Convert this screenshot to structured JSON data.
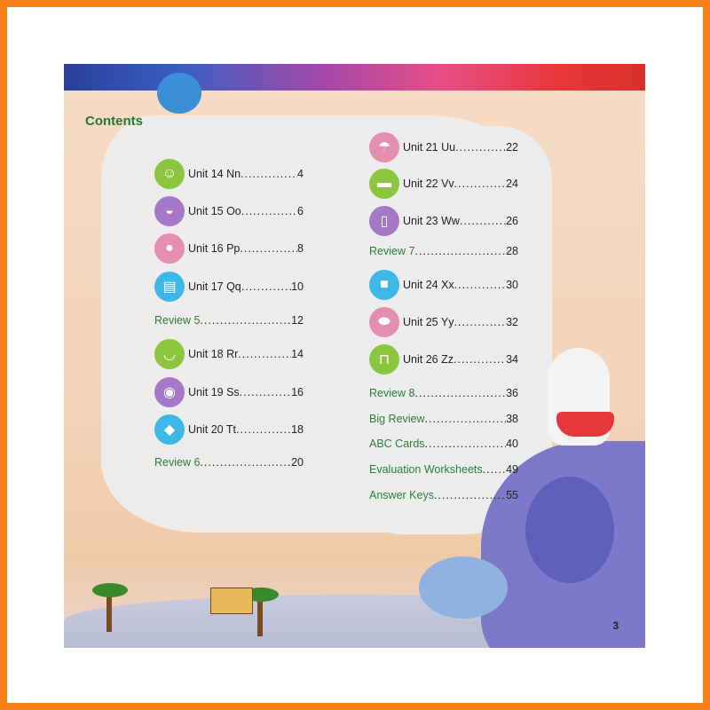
{
  "title": "Contents",
  "page_number": "3",
  "colors": {
    "accent_green": "#2a7d3c",
    "border_orange": "#f57f17"
  },
  "left_column": [
    {
      "label": "Unit 14 Nn",
      "page": "4",
      "icon": "boy-face-icon",
      "icon_color": "#8cc63f"
    },
    {
      "label": "Unit 15 Oo",
      "page": "6",
      "icon": "omelet-plate-icon",
      "icon_color": "#a678c8"
    },
    {
      "label": "Unit 16 Pp",
      "page": "8",
      "icon": "pear-icon",
      "icon_color": "#e48fb0"
    },
    {
      "label": "Unit 17 Qq",
      "page": "10",
      "icon": "quilt-icon",
      "icon_color": "#3db8e6"
    },
    {
      "label": "Review 5",
      "page": "12",
      "review": true
    },
    {
      "label": "Unit 18 Rr",
      "page": "14",
      "icon": "rice-bowl-icon",
      "icon_color": "#8cc63f"
    },
    {
      "label": "Unit 19 Ss",
      "page": "16",
      "icon": "soup-icon",
      "icon_color": "#a678c8"
    },
    {
      "label": "Unit 20 Tt",
      "page": "18",
      "icon": "toast-icon",
      "icon_color": "#3db8e6"
    },
    {
      "label": "Review 6",
      "page": "20",
      "review": true
    }
  ],
  "right_column": [
    {
      "label": "Unit 21 Uu",
      "page": "22",
      "icon": "umbrella-icon",
      "icon_color": "#e48fb0"
    },
    {
      "label": "Unit 22 Vv",
      "page": "24",
      "icon": "van-icon",
      "icon_color": "#8cc63f"
    },
    {
      "label": "Unit 23 Ww",
      "page": "26",
      "icon": "water-glass-icon",
      "icon_color": "#a678c8"
    },
    {
      "label": "Review 7",
      "page": "28",
      "review": true
    },
    {
      "label": "Unit 24 Xx",
      "page": "30",
      "icon": "box-icon",
      "icon_color": "#3db8e6"
    },
    {
      "label": "Unit 25 Yy",
      "page": "32",
      "icon": "yam-icon",
      "icon_color": "#e48fb0"
    },
    {
      "label": "Unit 26 Zz",
      "page": "34",
      "icon": "zipline-icon",
      "icon_color": "#8cc63f"
    },
    {
      "label": "Review 8",
      "page": "36",
      "review": true
    },
    {
      "label": "Big Review",
      "page": "38",
      "review": true
    },
    {
      "label": "ABC Cards",
      "page": "40",
      "review": true
    },
    {
      "label": "Evaluation Worksheets",
      "page": "49",
      "review": true
    },
    {
      "label": "Answer Keys",
      "page": "55",
      "review": true
    }
  ]
}
